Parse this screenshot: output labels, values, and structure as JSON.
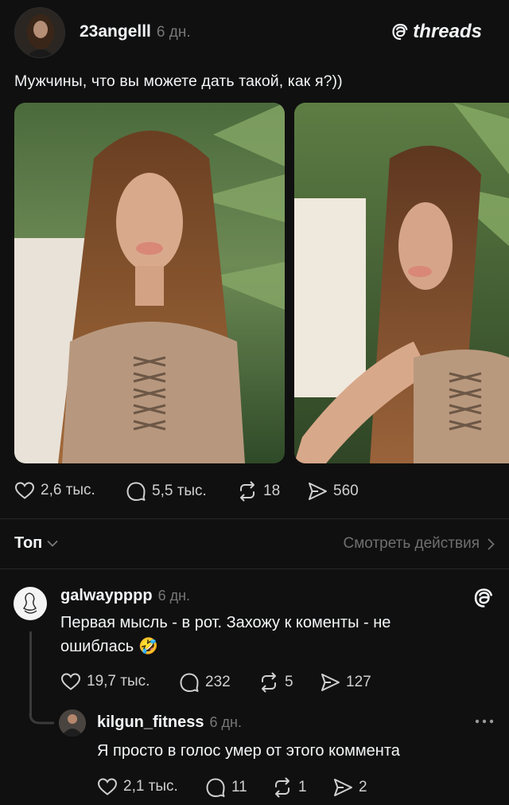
{
  "post": {
    "username": "23angelll",
    "time": "6 дн.",
    "brand": "threads",
    "text": "Мужчины, что вы можете дать такой, как я?))",
    "metrics": {
      "likes": "2,6 тыс.",
      "comments": "5,5 тыс.",
      "reposts": "18",
      "shares": "560"
    }
  },
  "sort": {
    "label": "Топ",
    "activity_link": "Смотреть действия"
  },
  "comments": [
    {
      "username": "galwaypppp",
      "time": "6 дн.",
      "text_line1": "Первая мысль - в рот. Захожу к коменты - не",
      "text_line2": "ошиблась",
      "emoji": "🤣",
      "likes": "19,7 тыс.",
      "replies": "232",
      "reposts": "5",
      "shares": "127"
    },
    {
      "username": "kilgun_fitness",
      "time": "6 дн.",
      "text": "Я просто в голос умер от этого коммента",
      "likes": "2,1 тыс.",
      "replies": "11",
      "reposts": "1",
      "shares": "2"
    }
  ],
  "colors": {
    "background": "#101010",
    "text": "#f3f5f7",
    "muted": "#777777"
  }
}
